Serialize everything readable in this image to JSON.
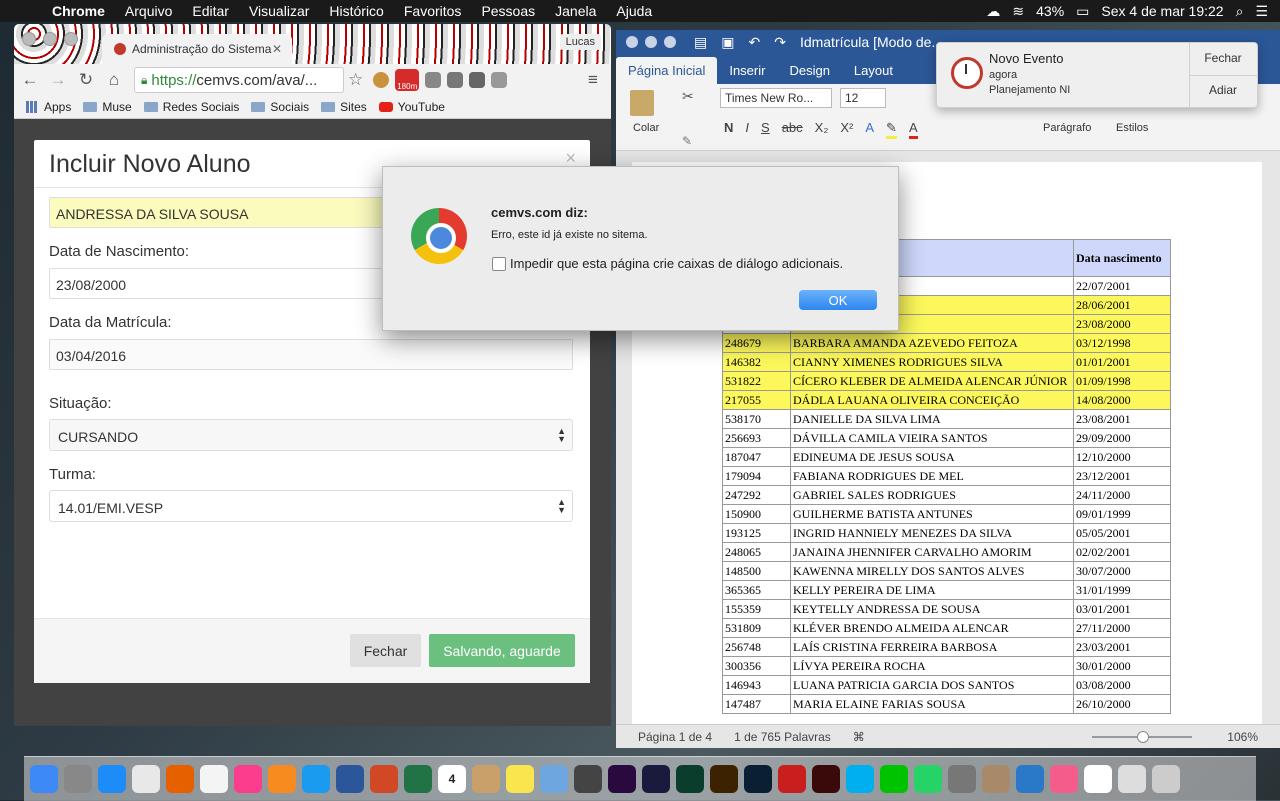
{
  "menubar": {
    "app": "Chrome",
    "items": [
      "Arquivo",
      "Editar",
      "Visualizar",
      "Histórico",
      "Favoritos",
      "Pessoas",
      "Janela",
      "Ajuda"
    ],
    "battery": "43%",
    "datetime": "Sex 4 de mar  19:22"
  },
  "chrome": {
    "tab_title": "Administração do Sistema",
    "profile": "Lucas",
    "url_https": "https://",
    "url_rest": "cemvs.com/ava/...",
    "ext_badge": "180m",
    "bookmarks": [
      "Apps",
      "Muse",
      "Redes Sociais",
      "Sociais",
      "Sites",
      "YouTube"
    ]
  },
  "modal": {
    "title": "Incluir Novo Aluno",
    "close": "×",
    "name_value": "ANDRESSA DA SILVA SOUSA",
    "birth_label": "Data de Nascimento:",
    "birth_value": "23/08/2000",
    "enroll_label": "Data da Matrícula:",
    "enroll_value": "03/04/2016",
    "status_label": "Situação:",
    "status_value": "CURSANDO",
    "class_label": "Turma:",
    "class_value": "14.01/EMI.VESP",
    "close_button": "Fechar",
    "save_button": "Salvando, aguarde"
  },
  "alert": {
    "title": "cemvs.com diz:",
    "message": "Erro, este id já existe no sitema.",
    "checkbox": "Impedir que esta página crie caixas de diálogo adicionais.",
    "ok": "OK"
  },
  "notification": {
    "title": "Novo Evento",
    "time": "agora",
    "subtitle": "Planejamento NI",
    "btn_close": "Fechar",
    "btn_snooze": "Adiar"
  },
  "word": {
    "doc_title": "Idmatrícula [Modo de...",
    "tabs": [
      "Página Inicial",
      "Inserir",
      "Design",
      "Layout"
    ],
    "font_name": "Times New Ro...",
    "font_size": "12",
    "paste_label": "Colar",
    "paragraph_label": "Parágrafo",
    "styles_label": "Estilos",
    "table_header_date": "Data nascimento",
    "rows": [
      {
        "id": "",
        "name": "RA DA SILVA",
        "date": "22/07/2001",
        "hl": false
      },
      {
        "id": "",
        "name": "LVA SOUSA",
        "date": "28/06/2001",
        "hl": true
      },
      {
        "id": "",
        "name": "ANTOS PEREIRA",
        "date": "23/08/2000",
        "hl": true
      },
      {
        "id": "248679",
        "name": "BARBARA AMANDA AZEVEDO FEITOZA",
        "date": "03/12/1998",
        "hl": true
      },
      {
        "id": "146382",
        "name": "CIANNY XIMENES RODRIGUES SILVA",
        "date": "01/01/2001",
        "hl": true
      },
      {
        "id": "531822",
        "name": "CÍCERO KLEBER DE ALMEIDA ALENCAR JÚNIOR",
        "date": "01/09/1998",
        "hl": true
      },
      {
        "id": "217055",
        "name": "DÁDLA LAUANA OLIVEIRA CONCEIÇÃO",
        "date": "14/08/2000",
        "hl": true
      },
      {
        "id": "538170",
        "name": "DANIELLE DA SILVA LIMA",
        "date": "23/08/2001",
        "hl": false
      },
      {
        "id": "256693",
        "name": "DÁVILLA CAMILA VIEIRA SANTOS",
        "date": "29/09/2000",
        "hl": false
      },
      {
        "id": "187047",
        "name": "EDINEUMA DE JESUS SOUSA",
        "date": "12/10/2000",
        "hl": false
      },
      {
        "id": "179094",
        "name": "FABIANA RODRIGUES DE MEL",
        "date": "23/12/2001",
        "hl": false
      },
      {
        "id": "247292",
        "name": "GABRIEL SALES RODRIGUES",
        "date": "24/11/2000",
        "hl": false
      },
      {
        "id": "150900",
        "name": "GUILHERME BATISTA ANTUNES",
        "date": "09/01/1999",
        "hl": false
      },
      {
        "id": "193125",
        "name": "INGRID HANNIELY MENEZES DA SILVA",
        "date": "05/05/2001",
        "hl": false
      },
      {
        "id": "248065",
        "name": "JANAINA JHENNIFER CARVALHO AMORIM",
        "date": "02/02/2001",
        "hl": false
      },
      {
        "id": "148500",
        "name": "KAWENNA MIRELLY DOS SANTOS ALVES",
        "date": "30/07/2000",
        "hl": false
      },
      {
        "id": "365365",
        "name": "KELLY PEREIRA DE LIMA",
        "date": "31/01/1999",
        "hl": false
      },
      {
        "id": "155359",
        "name": "KEYTELLY ANDRESSA DE SOUSA",
        "date": "03/01/2001",
        "hl": false
      },
      {
        "id": "531809",
        "name": "KLÉVER BRENDO ALMEIDA ALENCAR",
        "date": "27/11/2000",
        "hl": false
      },
      {
        "id": "256748",
        "name": "LAÍS CRISTINA FERREIRA BARBOSA",
        "date": "23/03/2001",
        "hl": false
      },
      {
        "id": "300356",
        "name": "LÍVYA PEREIRA ROCHA",
        "date": "30/01/2000",
        "hl": false
      },
      {
        "id": "146943",
        "name": "LUANA PATRICIA GARCIA DOS SANTOS",
        "date": "03/08/2000",
        "hl": false
      },
      {
        "id": "147487",
        "name": "MARIA ELAINE FARIAS SOUSA",
        "date": "26/10/2000",
        "hl": false
      }
    ],
    "status_page": "Página 1 de 4",
    "status_words": "1 de 765 Palavras",
    "zoom": "106%"
  },
  "dock": {
    "calendar_day": "4",
    "items": [
      "finder-icon",
      "launchpad-icon",
      "safari-icon",
      "chrome-icon",
      "firefox-icon",
      "photos-icon",
      "itunes-icon",
      "ibooks-icon",
      "appstore-icon",
      "word-icon",
      "powerpoint-icon",
      "excel-icon",
      "calendar-icon",
      "notes-icon",
      "stickies-icon",
      "preview-icon",
      "character-icon",
      "premiere-icon",
      "aftereffects-icon",
      "muse-icon",
      "illustrator-icon",
      "photoshop-icon",
      "acrobat-icon",
      "animate-icon",
      "skype-icon",
      "line-icon",
      "whatsapp-icon",
      "preferences-icon",
      "archive-icon",
      "edge-icon",
      "cocktail-icon",
      "textedit-icon",
      "keyboard-icon",
      "trash-icon"
    ]
  }
}
